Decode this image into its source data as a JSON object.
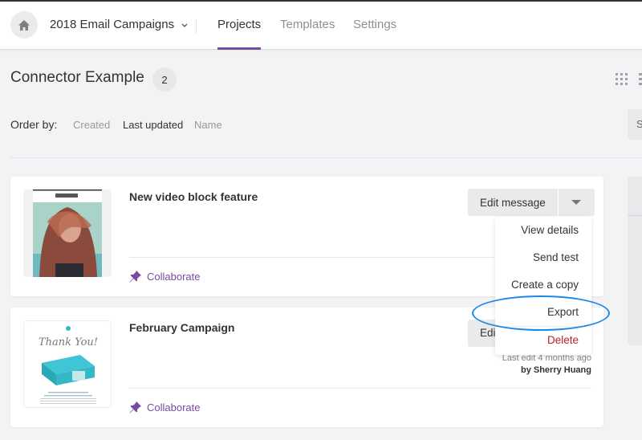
{
  "topbar": {
    "home_icon": "home-icon",
    "workspace_name": "2018 Email Campaigns",
    "tabs": [
      {
        "label": "Projects",
        "active": true
      },
      {
        "label": "Templates",
        "active": false
      },
      {
        "label": "Settings",
        "active": false
      }
    ]
  },
  "header": {
    "title": "Connector Example",
    "count": "2",
    "view_icons": [
      "grid-view-icon",
      "list-view-icon"
    ]
  },
  "order": {
    "label": "Order by:",
    "options": [
      {
        "label": "Created",
        "active": false
      },
      {
        "label": "Last updated",
        "active": true
      },
      {
        "label": "Name",
        "active": false
      }
    ]
  },
  "search_stub_text": "S",
  "projects": [
    {
      "title": "New video block feature",
      "thumbnail_header": "WOMAN",
      "collaborate_label": "Collaborate",
      "edit_label": "Edit message"
    },
    {
      "title": "February Campaign",
      "thumbnail_text": "Thank You!",
      "collaborate_label": "Collaborate",
      "edit_label": "Edi",
      "last_edit": "Last edit 4 months ago",
      "author": "by Sherry Huang"
    }
  ],
  "dropdown": {
    "items": [
      {
        "label": "View details"
      },
      {
        "label": "Send test"
      },
      {
        "label": "Create a copy"
      },
      {
        "label": "Export",
        "highlighted": true
      },
      {
        "label": "Delete",
        "danger": true
      }
    ]
  },
  "colors": {
    "accent": "#7a4aa1",
    "danger": "#b0222c",
    "highlight": "#1e88e5",
    "background": "#f2f3f5"
  }
}
